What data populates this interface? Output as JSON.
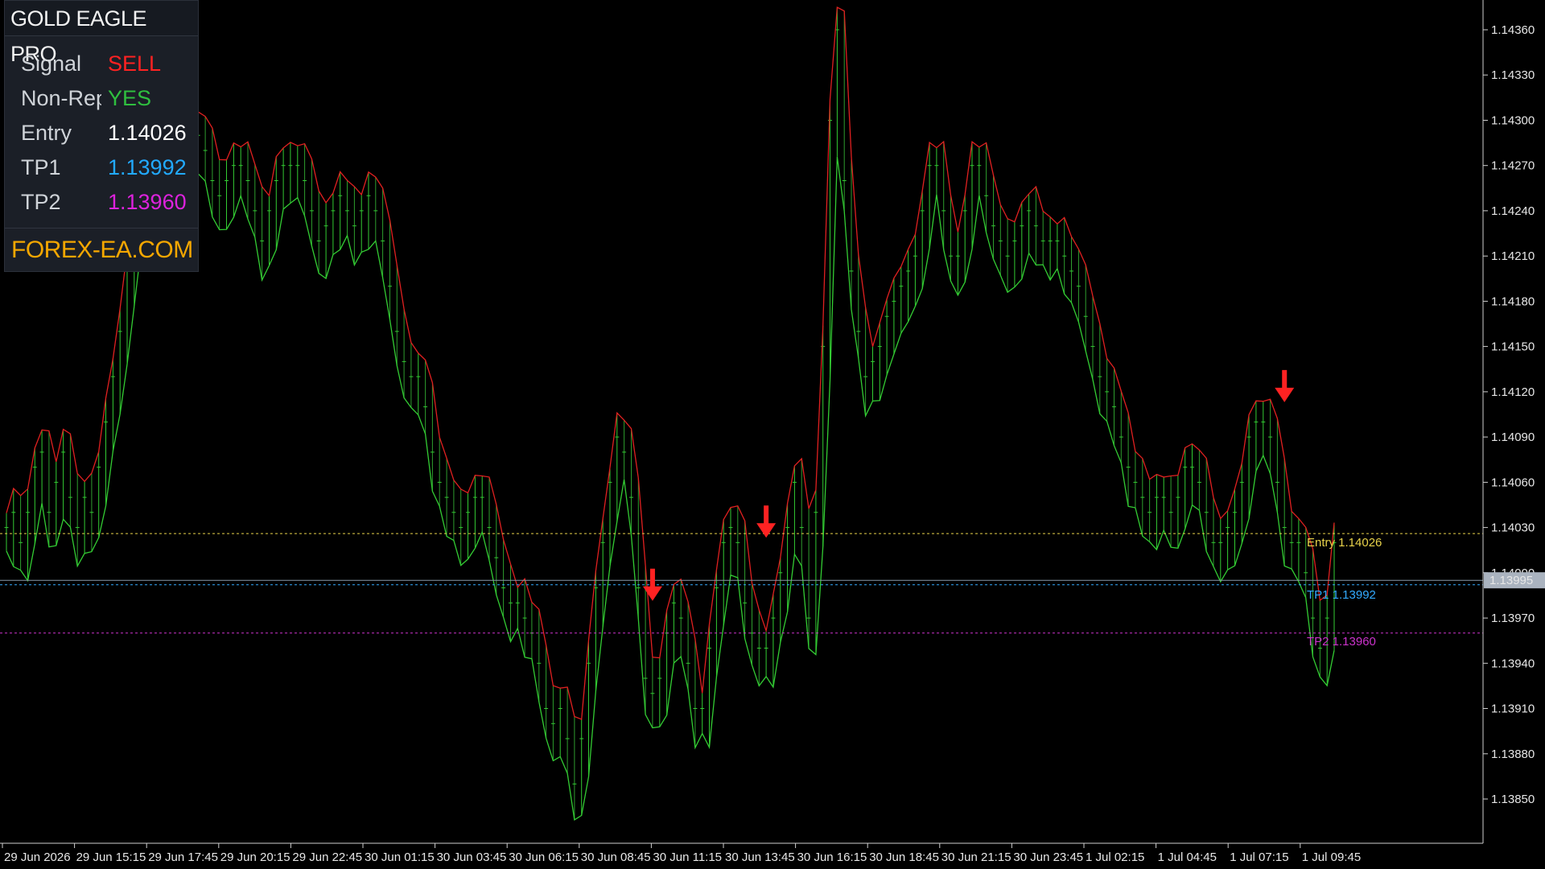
{
  "colors": {
    "background": "#000000",
    "bull": "#33cc33",
    "bear": "#e02020",
    "grid_text": "#e6e6e6",
    "entry": "#e8d24a",
    "tp1": "#33aaff",
    "tp2": "#cc33cc",
    "sell": "#ff2222",
    "yes": "#2fbf3f",
    "brand": "#f5a700"
  },
  "panel": {
    "title": "GOLD EAGLE PRO",
    "rows": [
      {
        "label": "Signal",
        "value": "SELL"
      },
      {
        "label": "Non-Repaint",
        "value": "YES"
      },
      {
        "label": "Entry",
        "value": "1.14026"
      },
      {
        "label": "TP1",
        "value": "1.13992"
      },
      {
        "label": "TP2",
        "value": "1.13960"
      }
    ],
    "footer": "FOREX-EA.COM"
  },
  "levels": {
    "entry": {
      "label": "Entry 1.14026",
      "price": 1.14026
    },
    "tp1": {
      "label": "TP1 1.13992",
      "price": 1.13992
    },
    "tp2": {
      "label": "TP2 1.13960",
      "price": 1.1396
    },
    "current": {
      "label": "1.13995",
      "price": 1.13995
    }
  },
  "chart_data": {
    "type": "line",
    "ylim": [
      1.1382,
      1.1438
    ],
    "y_ticks": [
      "1.14360",
      "1.14330",
      "1.14300",
      "1.14270",
      "1.14240",
      "1.14210",
      "1.14180",
      "1.14150",
      "1.14120",
      "1.14090",
      "1.14060",
      "1.14030",
      "1.14000",
      "1.13970",
      "1.13940",
      "1.13910",
      "1.13880",
      "1.13850"
    ],
    "x_ticks": [
      "29 Jun 2026",
      "29 Jun 15:15",
      "29 Jun 17:45",
      "29 Jun 20:15",
      "29 Jun 22:45",
      "30 Jun 01:15",
      "30 Jun 03:45",
      "30 Jun 06:15",
      "30 Jun 08:45",
      "30 Jun 11:15",
      "30 Jun 13:45",
      "30 Jun 16:15",
      "30 Jun 18:45",
      "30 Jun 21:15",
      "30 Jun 23:45",
      "1 Jul 02:15",
      "1 Jul 04:45",
      "1 Jul 07:15",
      "1 Jul 09:45"
    ],
    "sell_arrows_bar": [
      91,
      107,
      180
    ],
    "close": [
      1.1403,
      1.1404,
      1.1402,
      1.1404,
      1.1407,
      1.1408,
      1.1404,
      1.1406,
      1.1408,
      1.1405,
      1.1403,
      1.1405,
      1.1404,
      1.1407,
      1.141,
      1.1413,
      1.1416,
      1.142,
      1.1424,
      1.1426,
      1.1424,
      1.1427,
      1.1428,
      1.1426,
      1.1427,
      1.1428,
      1.1429,
      1.1429,
      1.1428,
      1.1426,
      1.1425,
      1.1426,
      1.1427,
      1.1427,
      1.1426,
      1.1424,
      1.1422,
      1.1424,
      1.1426,
      1.1427,
      1.1427,
      1.1427,
      1.1426,
      1.1424,
      1.1422,
      1.1423,
      1.1424,
      1.1425,
      1.1424,
      1.1423,
      1.1424,
      1.1425,
      1.1424,
      1.1422,
      1.1419,
      1.1416,
      1.1414,
      1.1413,
      1.1413,
      1.1411,
      1.1408,
      1.1406,
      1.1405,
      1.1404,
      1.1403,
      1.1404,
      1.1405,
      1.1405,
      1.1403,
      1.1401,
      1.1399,
      1.1398,
      1.1398,
      1.1397,
      1.1396,
      1.1394,
      1.1391,
      1.139,
      1.1391,
      1.1389,
      1.1386,
      1.1389,
      1.1394,
      1.1399,
      1.1402,
      1.1406,
      1.1409,
      1.1408,
      1.1405,
      1.1399,
      1.1393,
      1.1392,
      1.1393,
      1.1396,
      1.1398,
      1.1397,
      1.1394,
      1.1391,
      1.1391,
      1.1395,
      1.1399,
      1.1402,
      1.1403,
      1.1402,
      1.1398,
      1.1396,
      1.1395,
      1.1395,
      1.1397,
      1.14,
      1.1403,
      1.1406,
      1.1403,
      1.1397,
      1.1404,
      1.1415,
      1.143,
      1.1436,
      1.1426,
      1.142,
      1.1416,
      1.1413,
      1.1414,
      1.1415,
      1.1417,
      1.1418,
      1.1419,
      1.142,
      1.1421,
      1.1424,
      1.1427,
      1.1427,
      1.1424,
      1.1421,
      1.1421,
      1.1424,
      1.1427,
      1.1427,
      1.1425,
      1.1423,
      1.1422,
      1.1421,
      1.1422,
      1.1423,
      1.1424,
      1.1423,
      1.1422,
      1.1422,
      1.1422,
      1.1421,
      1.142,
      1.1419,
      1.1417,
      1.1415,
      1.1413,
      1.1412,
      1.1411,
      1.1409,
      1.1407,
      1.1406,
      1.1405,
      1.1404,
      1.1405,
      1.1405,
      1.1404,
      1.1405,
      1.1407,
      1.1407,
      1.1406,
      1.1404,
      1.1402,
      1.1402,
      1.1403,
      1.1404,
      1.1406,
      1.1409,
      1.141,
      1.141,
      1.1409,
      1.1406,
      1.1403,
      1.1402,
      1.1402,
      1.14,
      1.1397,
      1.1395,
      1.1397,
      1.1402
    ]
  }
}
